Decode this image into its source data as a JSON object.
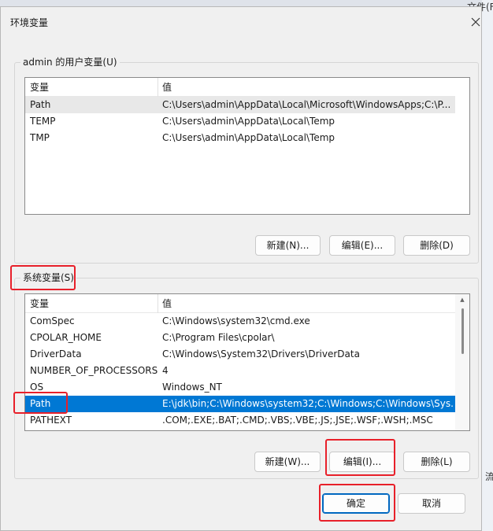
{
  "window": {
    "title": "环境变量"
  },
  "background": {
    "label": "文件(F",
    "char": "流"
  },
  "user_vars": {
    "group_label": "admin 的用户变量(U)",
    "columns": [
      "变量",
      "值"
    ],
    "rows": [
      {
        "name": "Path",
        "value": "C:\\Users\\admin\\AppData\\Local\\Microsoft\\WindowsApps;C:\\P..."
      },
      {
        "name": "TEMP",
        "value": "C:\\Users\\admin\\AppData\\Local\\Temp"
      },
      {
        "name": "TMP",
        "value": "C:\\Users\\admin\\AppData\\Local\\Temp"
      }
    ],
    "buttons": {
      "new": "新建(N)...",
      "edit": "编辑(E)...",
      "delete": "删除(D)"
    }
  },
  "system_vars": {
    "group_label": "系统变量(S)",
    "columns": [
      "变量",
      "值"
    ],
    "rows": [
      {
        "name": "ComSpec",
        "value": "C:\\Windows\\system32\\cmd.exe"
      },
      {
        "name": "CPOLAR_HOME",
        "value": "C:\\Program Files\\cpolar\\"
      },
      {
        "name": "DriverData",
        "value": "C:\\Windows\\System32\\Drivers\\DriverData"
      },
      {
        "name": "NUMBER_OF_PROCESSORS",
        "value": "4"
      },
      {
        "name": "OS",
        "value": "Windows_NT"
      },
      {
        "name": "Path",
        "value": "E:\\jdk\\bin;C:\\Windows\\system32;C:\\Windows;C:\\Windows\\Sys..."
      },
      {
        "name": "PATHEXT",
        "value": ".COM;.EXE;.BAT;.CMD;.VBS;.VBE;.JS;.JSE;.WSF;.WSH;.MSC"
      }
    ],
    "selected_row": "Path",
    "buttons": {
      "new": "新建(W)...",
      "edit": "编辑(I)...",
      "delete": "删除(L)"
    }
  },
  "footer": {
    "ok": "确定",
    "cancel": "取消"
  },
  "colors": {
    "selection": "#0078d4",
    "highlight_box": "#e8202a",
    "primary_border": "#0067c0"
  }
}
